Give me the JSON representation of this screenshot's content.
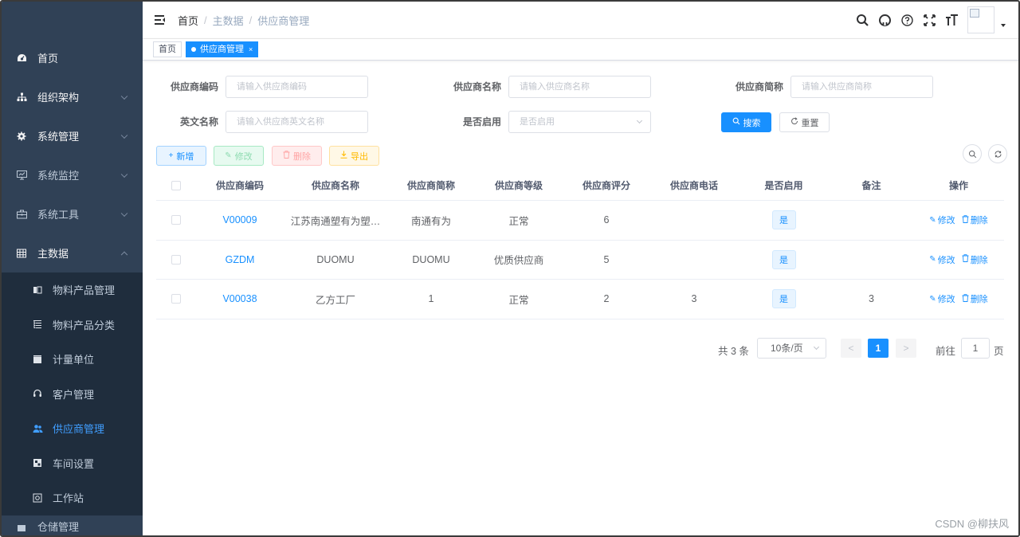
{
  "sidebar": {
    "menu": [
      {
        "label": "首页",
        "icon": "dashboard-icon",
        "expandable": false
      },
      {
        "label": "组织架构",
        "icon": "tree-icon",
        "expandable": true
      },
      {
        "label": "系统管理",
        "icon": "gear-icon",
        "expandable": true
      },
      {
        "label": "系统监控",
        "icon": "monitor-icon",
        "expandable": true
      },
      {
        "label": "系统工具",
        "icon": "tool-icon",
        "expandable": true
      },
      {
        "label": "主数据",
        "icon": "table-icon",
        "expandable": true,
        "expanded": true
      }
    ],
    "submenu": [
      {
        "label": "物料产品管理",
        "icon": "box-icon"
      },
      {
        "label": "物料产品分类",
        "icon": "tree-table-icon"
      },
      {
        "label": "计量单位",
        "icon": "clapper-icon"
      },
      {
        "label": "客户管理",
        "icon": "headset-icon"
      },
      {
        "label": "供应商管理",
        "icon": "peoples-icon",
        "active": true
      },
      {
        "label": "车间设置",
        "icon": "workshop-icon"
      },
      {
        "label": "工作站",
        "icon": "station-icon"
      }
    ],
    "partial_item": {
      "label": "仓储管理"
    }
  },
  "navbar": {
    "breadcrumb": [
      "首页",
      "主数据",
      "供应商管理"
    ],
    "separator": "/"
  },
  "tags": [
    {
      "label": "首页",
      "active": false
    },
    {
      "label": "供应商管理",
      "active": true,
      "close": "×"
    }
  ],
  "search_form": {
    "fields": [
      {
        "label": "供应商编码",
        "placeholder": "请输入供应商编码"
      },
      {
        "label": "供应商名称",
        "placeholder": "请输入供应商名称"
      },
      {
        "label": "供应商简称",
        "placeholder": "请输入供应商简称"
      },
      {
        "label": "英文名称",
        "placeholder": "请输入供应商英文名称"
      },
      {
        "label": "是否启用",
        "placeholder": "是否启用",
        "type": "select"
      }
    ],
    "search_button": "搜索",
    "reset_button": "重置"
  },
  "toolbar": {
    "add": "新增",
    "edit": "修改",
    "delete": "删除",
    "export": "导出"
  },
  "table": {
    "headers": [
      "供应商编码",
      "供应商名称",
      "供应商简称",
      "供应商等级",
      "供应商评分",
      "供应商电话",
      "是否启用",
      "备注",
      "操作"
    ],
    "rows": [
      {
        "code": "V00009",
        "name": "江苏南通塑有为塑…",
        "short": "南通有为",
        "level": "正常",
        "score": "6",
        "phone": "",
        "enabled": "是",
        "remark": ""
      },
      {
        "code": "GZDM",
        "name": "DUOMU",
        "short": "DUOMU",
        "level": "优质供应商",
        "score": "5",
        "phone": "",
        "enabled": "是",
        "remark": ""
      },
      {
        "code": "V00038",
        "name": "乙方工厂",
        "short": "1",
        "level": "正常",
        "score": "2",
        "phone": "3",
        "enabled": "是",
        "remark": "3"
      }
    ],
    "row_actions": {
      "edit": "修改",
      "delete": "删除"
    }
  },
  "pagination": {
    "total": "共 3 条",
    "page_size": "10条/页",
    "prev": "<",
    "next": ">",
    "current_page": "1",
    "jump_label": "前往",
    "jump_value": "1",
    "page_suffix": "页"
  },
  "watermark": "CSDN @柳扶风",
  "colors": {
    "sidebar_bg": "#304156",
    "submenu_bg": "#1f2d3d",
    "primary": "#1890ff"
  }
}
